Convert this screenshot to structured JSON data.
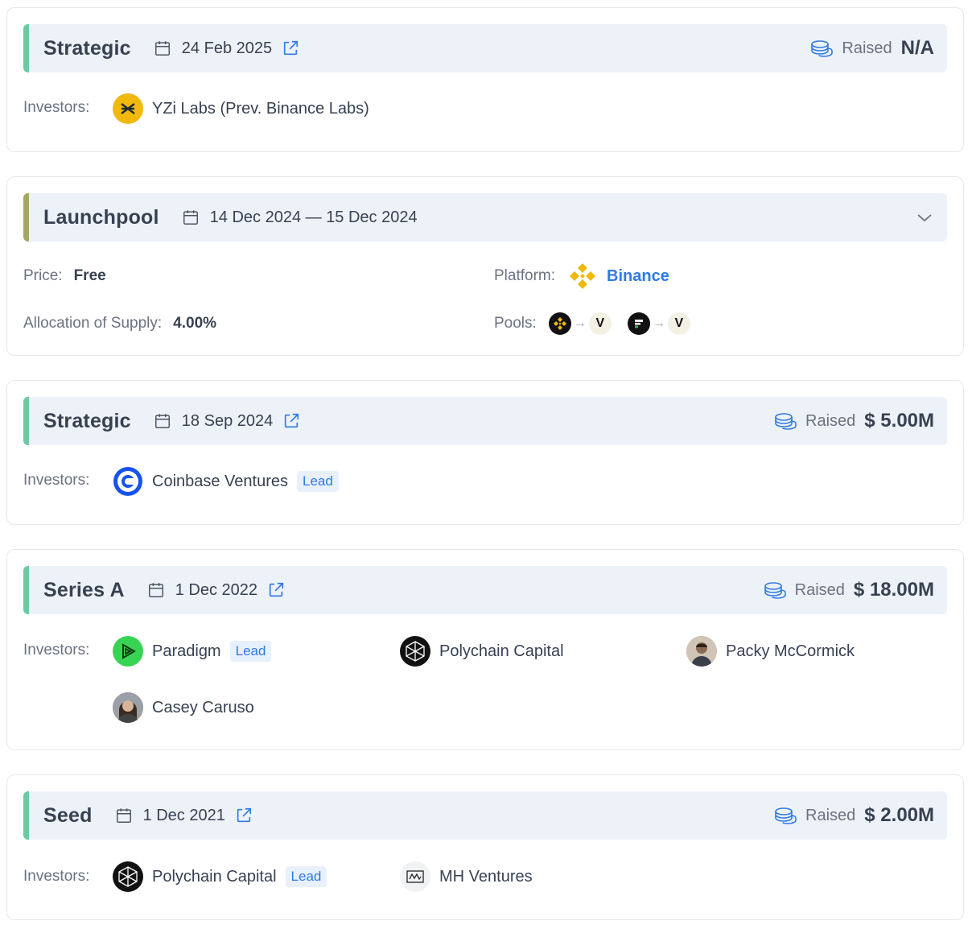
{
  "rounds": [
    {
      "title": "Strategic",
      "date": "24 Feb 2025",
      "raised_label": "Raised",
      "raised_value": "N/A",
      "investors_label": "Investors:",
      "investors": [
        {
          "name": "YZi Labs (Prev. Binance Labs)",
          "logo": "yzi-labs-logo"
        }
      ]
    },
    {
      "title": "Launchpool",
      "date": "14 Dec 2024 — 15 Dec 2024",
      "price_label": "Price:",
      "price_value": "Free",
      "allocation_label": "Allocation of Supply:",
      "allocation_value": "4.00%",
      "platform_label": "Platform:",
      "platform_value": "Binance",
      "pools_label": "Pools:",
      "pools": [
        {
          "from": "BNB",
          "to": "V"
        },
        {
          "from": "FDUSD",
          "to": "V"
        }
      ]
    },
    {
      "title": "Strategic",
      "date": "18 Sep 2024",
      "raised_label": "Raised",
      "raised_value": "$ 5.00M",
      "investors_label": "Investors:",
      "investors": [
        {
          "name": "Coinbase Ventures",
          "lead": "Lead",
          "logo": "coinbase-logo"
        }
      ]
    },
    {
      "title": "Series A",
      "date": "1 Dec 2022",
      "raised_label": "Raised",
      "raised_value": "$ 18.00M",
      "investors_label": "Investors:",
      "investors": [
        {
          "name": "Paradigm",
          "lead": "Lead",
          "logo": "paradigm-logo"
        },
        {
          "name": "Polychain Capital",
          "logo": "polychain-logo"
        },
        {
          "name": "Packy McCormick",
          "logo": "avatar"
        },
        {
          "name": "Casey Caruso",
          "logo": "avatar"
        }
      ]
    },
    {
      "title": "Seed",
      "date": "1 Dec 2021",
      "raised_label": "Raised",
      "raised_value": "$ 2.00M",
      "investors_label": "Investors:",
      "investors": [
        {
          "name": "Polychain Capital",
          "lead": "Lead",
          "logo": "polychain-logo"
        },
        {
          "name": "MH Ventures",
          "logo": "mh-ventures-logo"
        }
      ]
    }
  ],
  "colors": {
    "accent_green": "#6cc9a1",
    "accent_olive": "#a6a56a",
    "link_blue": "#2f7ae5",
    "header_bg": "#edf2f9",
    "binance_yellow": "#f0b90b"
  }
}
